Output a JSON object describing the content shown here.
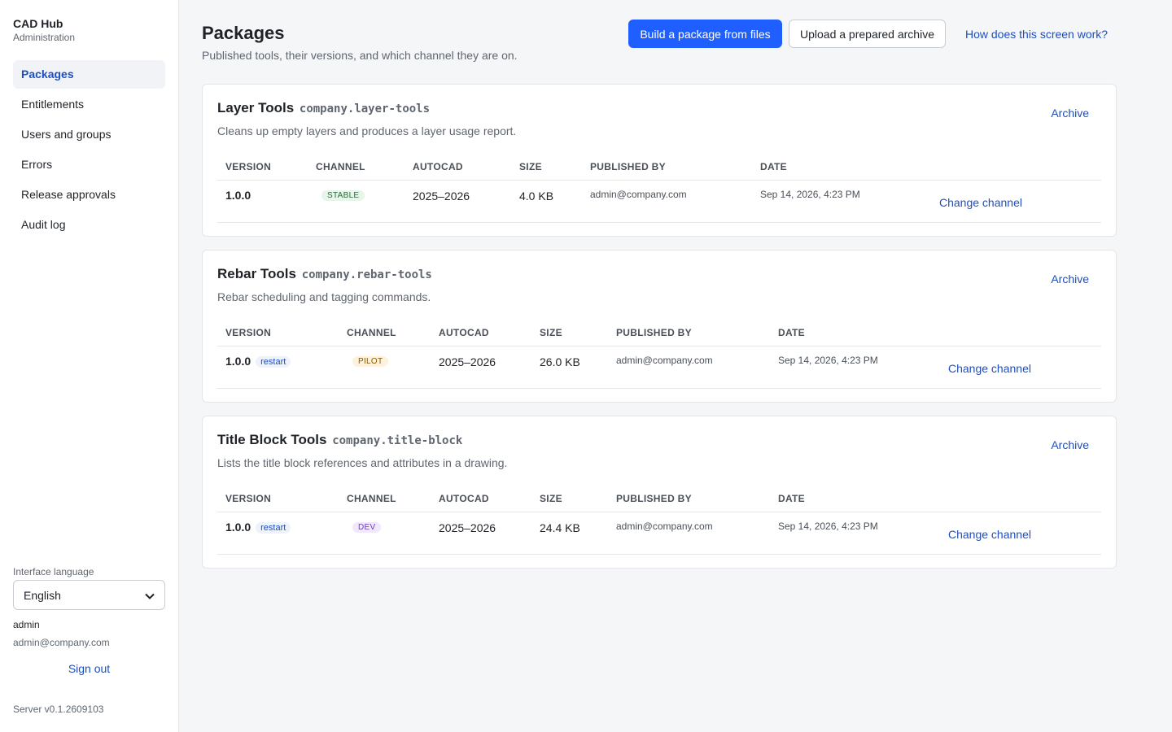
{
  "sidebar": {
    "brand": "CAD Hub",
    "subtitle": "Administration",
    "nav": [
      "Packages",
      "Entitlements",
      "Users and groups",
      "Errors",
      "Release approvals",
      "Audit log"
    ],
    "language_label": "Interface language",
    "language_value": "English",
    "user_name": "admin",
    "user_email": "admin@company.com",
    "sign_out": "Sign out",
    "server_version": "Server v0.1.2609103"
  },
  "header": {
    "title": "Packages",
    "subtitle": "Published tools, their versions, and which channel they are on.",
    "build_button": "Build a package from files",
    "upload_button": "Upload a prepared archive",
    "help_link": "How does this screen work?"
  },
  "table_headers": [
    "VERSION",
    "CHANNEL",
    "AUTOCAD",
    "SIZE",
    "PUBLISHED BY",
    "DATE"
  ],
  "actions": {
    "archive": "Archive",
    "change_channel": "Change channel"
  },
  "packages": [
    {
      "name": "Layer Tools",
      "id": "company.layer-tools",
      "description": "Cleans up empty layers and produces a layer usage report.",
      "version": "1.0.0",
      "tag": "",
      "channel": "STABLE",
      "autocad": "2025–2026",
      "size": "4.0 KB",
      "published_by": "admin@company.com",
      "date": "Sep 14, 2026, 4:23 PM"
    },
    {
      "name": "Rebar Tools",
      "id": "company.rebar-tools",
      "description": "Rebar scheduling and tagging commands.",
      "version": "1.0.0",
      "tag": "restart",
      "channel": "PILOT",
      "autocad": "2025–2026",
      "size": "26.0 KB",
      "published_by": "admin@company.com",
      "date": "Sep 14, 2026, 4:23 PM"
    },
    {
      "name": "Title Block Tools",
      "id": "company.title-block",
      "description": "Lists the title block references and attributes in a drawing.",
      "version": "1.0.0",
      "tag": "restart",
      "channel": "DEV",
      "autocad": "2025–2026",
      "size": "24.4 KB",
      "published_by": "admin@company.com",
      "date": "Sep 14, 2026, 4:23 PM"
    }
  ]
}
